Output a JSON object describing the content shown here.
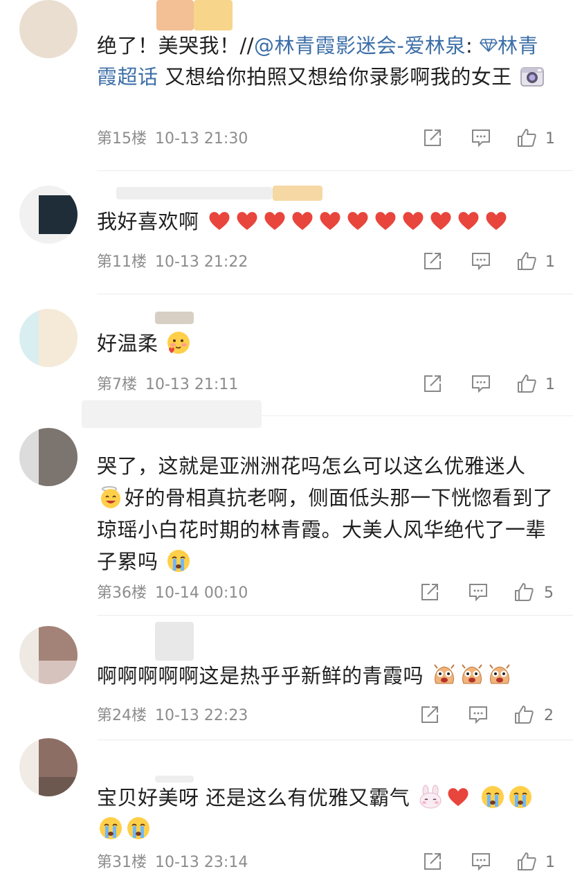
{
  "comments": [
    {
      "floor": "第15楼",
      "time": "10-13 21:30",
      "likes": "1",
      "text_plain_1": "绝了！美哭我！//",
      "mention": "@林青霞影迷会-爱林泉",
      "colon": ":",
      "topic_icon": "diamond-icon",
      "topic": "林青霞超话",
      "text_plain_2": " 又想给你拍照又想给你录影啊我的女王",
      "emoji": "camera-emoji"
    },
    {
      "floor": "第11楼",
      "time": "10-13 21:22",
      "likes": "1",
      "text": "我好喜欢啊",
      "emoji": "heart-emoji",
      "emoji_count": 11
    },
    {
      "floor": "第7楼",
      "time": "10-13 21:11",
      "likes": "1",
      "text": "好温柔",
      "emoji": "blush-heart-emoji"
    },
    {
      "floor": "第36楼",
      "time": "10-14 00:10",
      "likes": "5",
      "text_1": "哭了，这就是亚洲洲花吗怎么可以这么优雅迷人",
      "text_2": "好的骨相真抗老啊，侧面低头那一下恍惚看到了琼瑶小白花时期的林青霞。大美人风华绝代了一辈子累吗",
      "emoji_1": "angel-smile-emoji",
      "emoji_2": "crying-emoji"
    },
    {
      "floor": "第24楼",
      "time": "10-13 22:23",
      "likes": "2",
      "text": "啊啊啊啊啊这是热乎乎新鲜的青霞吗",
      "emoji": "doge-excited-emoji",
      "emoji_count": 3
    },
    {
      "floor": "第31楼",
      "time": "10-13 23:14",
      "likes": "1",
      "text": "宝贝好美呀 还是这么有优雅又霸气",
      "emojis": [
        "bunny-emoji",
        "heart-emoji",
        "crying-emoji",
        "crying-emoji",
        "crying-emoji",
        "crying-emoji"
      ]
    }
  ],
  "colors": {
    "link": "#3d6fa8",
    "meta": "#8c8c8c",
    "heart": "#e8453c"
  }
}
